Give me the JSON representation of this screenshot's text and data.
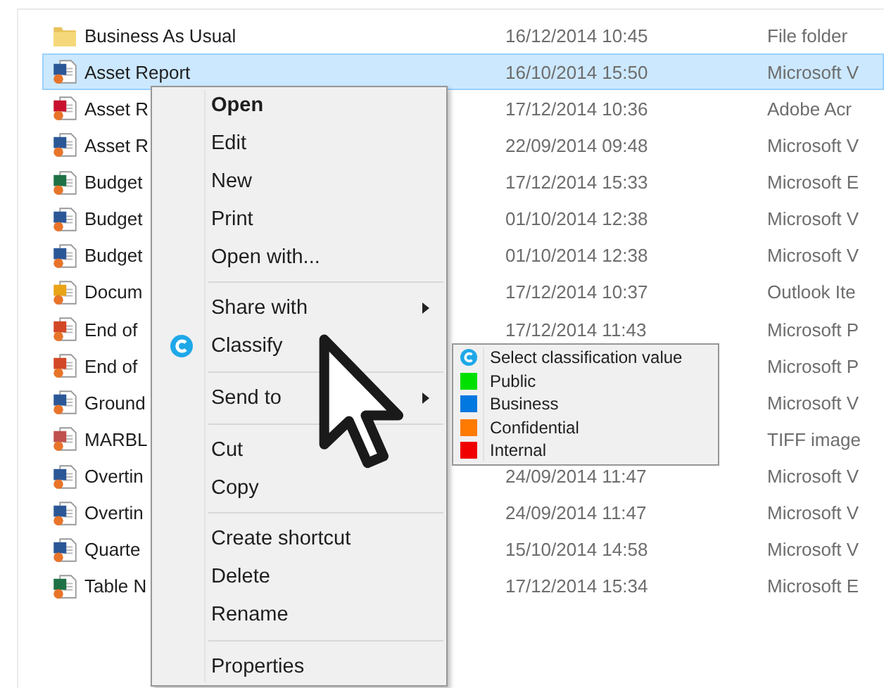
{
  "files": [
    {
      "kind": "folder",
      "name": "Business As Usual",
      "date": "16/12/2014 10:45",
      "type": "File folder",
      "selected": false
    },
    {
      "kind": "word",
      "name": "Asset Report",
      "date": "16/10/2014 15:50",
      "type": "Microsoft V",
      "selected": true
    },
    {
      "kind": "pdf",
      "name": "Asset R",
      "date": "17/12/2014 10:36",
      "type": "Adobe Acr",
      "selected": false
    },
    {
      "kind": "word",
      "name": "Asset R",
      "date": "22/09/2014 09:48",
      "type": "Microsoft V",
      "selected": false
    },
    {
      "kind": "excel",
      "name": "Budget",
      "date": "17/12/2014 15:33",
      "type": "Microsoft E",
      "selected": false
    },
    {
      "kind": "word",
      "name": "Budget",
      "date": "01/10/2014 12:38",
      "type": "Microsoft V",
      "selected": false
    },
    {
      "kind": "word",
      "name": "Budget",
      "date": "01/10/2014 12:38",
      "type": "Microsoft V",
      "selected": false
    },
    {
      "kind": "mail",
      "name": "Docum",
      "date": "17/12/2014 10:37",
      "type": "Outlook Ite",
      "selected": false
    },
    {
      "kind": "slides",
      "name": "End of",
      "date": "17/12/2014 11:43",
      "type": "Microsoft P",
      "selected": false
    },
    {
      "kind": "slides",
      "name": "End of",
      "type": "Microsoft P",
      "selected": false
    },
    {
      "kind": "word",
      "name": "Ground",
      "type": "Microsoft V",
      "selected": false
    },
    {
      "kind": "image",
      "name": "MARBL",
      "type": "TIFF image",
      "selected": false
    },
    {
      "kind": "word",
      "name": "Overtin",
      "date": "24/09/2014 11:47",
      "type": "Microsoft V",
      "selected": false
    },
    {
      "kind": "word",
      "name": "Overtin",
      "date": "24/09/2014 11:47",
      "type": "Microsoft V",
      "selected": false
    },
    {
      "kind": "word",
      "name": "Quarte",
      "date": "15/10/2014 14:58",
      "type": "Microsoft V",
      "selected": false
    },
    {
      "kind": "excel",
      "name": "Table N",
      "date": "17/12/2014 15:34",
      "type": "Microsoft E",
      "selected": false
    }
  ],
  "context_menu": [
    {
      "kind": "item",
      "label": "Open",
      "default": true,
      "icon": false,
      "submenu": false
    },
    {
      "kind": "item",
      "label": "Edit",
      "default": false,
      "icon": false,
      "submenu": false
    },
    {
      "kind": "item",
      "label": "New",
      "default": false,
      "icon": false,
      "submenu": false
    },
    {
      "kind": "item",
      "label": "Print",
      "default": false,
      "icon": false,
      "submenu": false
    },
    {
      "kind": "item",
      "label": "Open with...",
      "default": false,
      "icon": false,
      "submenu": false
    },
    {
      "kind": "separator"
    },
    {
      "kind": "item",
      "label": "Share with",
      "default": false,
      "icon": false,
      "submenu": true
    },
    {
      "kind": "item",
      "label": "Classify",
      "default": false,
      "icon": true,
      "submenu": false
    },
    {
      "kind": "separator"
    },
    {
      "kind": "item",
      "label": "Send to",
      "default": false,
      "icon": false,
      "submenu": true
    },
    {
      "kind": "separator"
    },
    {
      "kind": "item",
      "label": "Cut",
      "default": false,
      "icon": false,
      "submenu": false
    },
    {
      "kind": "item",
      "label": "Copy",
      "default": false,
      "icon": false,
      "submenu": false
    },
    {
      "kind": "separator"
    },
    {
      "kind": "item",
      "label": "Create shortcut",
      "default": false,
      "icon": false,
      "submenu": false
    },
    {
      "kind": "item",
      "label": "Delete",
      "default": false,
      "icon": false,
      "submenu": false
    },
    {
      "kind": "item",
      "label": "Rename",
      "default": false,
      "icon": false,
      "submenu": false
    },
    {
      "kind": "separator"
    },
    {
      "kind": "item",
      "label": "Properties",
      "default": false,
      "icon": false,
      "submenu": false
    }
  ],
  "classify_menu": [
    {
      "kind": "header",
      "label": "Select classification value"
    },
    {
      "kind": "value",
      "label": "Public",
      "color": "#00e000"
    },
    {
      "kind": "value",
      "label": "Business",
      "color": "#0078e0"
    },
    {
      "kind": "value",
      "label": "Confidential",
      "color": "#ff7a00"
    },
    {
      "kind": "value",
      "label": "Internal",
      "color": "#f00000"
    }
  ]
}
